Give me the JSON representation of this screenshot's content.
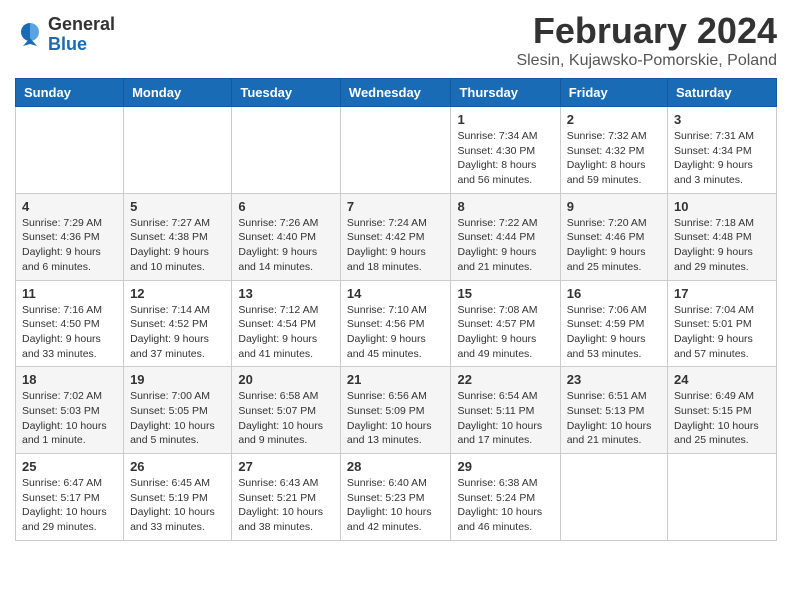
{
  "logo": {
    "general": "General",
    "blue": "Blue"
  },
  "title": {
    "month_year": "February 2024",
    "location": "Slesin, Kujawsko-Pomorskie, Poland"
  },
  "days_of_week": [
    "Sunday",
    "Monday",
    "Tuesday",
    "Wednesday",
    "Thursday",
    "Friday",
    "Saturday"
  ],
  "weeks": [
    [
      {
        "day": "",
        "info": ""
      },
      {
        "day": "",
        "info": ""
      },
      {
        "day": "",
        "info": ""
      },
      {
        "day": "",
        "info": ""
      },
      {
        "day": "1",
        "info": "Sunrise: 7:34 AM\nSunset: 4:30 PM\nDaylight: 8 hours\nand 56 minutes."
      },
      {
        "day": "2",
        "info": "Sunrise: 7:32 AM\nSunset: 4:32 PM\nDaylight: 8 hours\nand 59 minutes."
      },
      {
        "day": "3",
        "info": "Sunrise: 7:31 AM\nSunset: 4:34 PM\nDaylight: 9 hours\nand 3 minutes."
      }
    ],
    [
      {
        "day": "4",
        "info": "Sunrise: 7:29 AM\nSunset: 4:36 PM\nDaylight: 9 hours\nand 6 minutes."
      },
      {
        "day": "5",
        "info": "Sunrise: 7:27 AM\nSunset: 4:38 PM\nDaylight: 9 hours\nand 10 minutes."
      },
      {
        "day": "6",
        "info": "Sunrise: 7:26 AM\nSunset: 4:40 PM\nDaylight: 9 hours\nand 14 minutes."
      },
      {
        "day": "7",
        "info": "Sunrise: 7:24 AM\nSunset: 4:42 PM\nDaylight: 9 hours\nand 18 minutes."
      },
      {
        "day": "8",
        "info": "Sunrise: 7:22 AM\nSunset: 4:44 PM\nDaylight: 9 hours\nand 21 minutes."
      },
      {
        "day": "9",
        "info": "Sunrise: 7:20 AM\nSunset: 4:46 PM\nDaylight: 9 hours\nand 25 minutes."
      },
      {
        "day": "10",
        "info": "Sunrise: 7:18 AM\nSunset: 4:48 PM\nDaylight: 9 hours\nand 29 minutes."
      }
    ],
    [
      {
        "day": "11",
        "info": "Sunrise: 7:16 AM\nSunset: 4:50 PM\nDaylight: 9 hours\nand 33 minutes."
      },
      {
        "day": "12",
        "info": "Sunrise: 7:14 AM\nSunset: 4:52 PM\nDaylight: 9 hours\nand 37 minutes."
      },
      {
        "day": "13",
        "info": "Sunrise: 7:12 AM\nSunset: 4:54 PM\nDaylight: 9 hours\nand 41 minutes."
      },
      {
        "day": "14",
        "info": "Sunrise: 7:10 AM\nSunset: 4:56 PM\nDaylight: 9 hours\nand 45 minutes."
      },
      {
        "day": "15",
        "info": "Sunrise: 7:08 AM\nSunset: 4:57 PM\nDaylight: 9 hours\nand 49 minutes."
      },
      {
        "day": "16",
        "info": "Sunrise: 7:06 AM\nSunset: 4:59 PM\nDaylight: 9 hours\nand 53 minutes."
      },
      {
        "day": "17",
        "info": "Sunrise: 7:04 AM\nSunset: 5:01 PM\nDaylight: 9 hours\nand 57 minutes."
      }
    ],
    [
      {
        "day": "18",
        "info": "Sunrise: 7:02 AM\nSunset: 5:03 PM\nDaylight: 10 hours\nand 1 minute."
      },
      {
        "day": "19",
        "info": "Sunrise: 7:00 AM\nSunset: 5:05 PM\nDaylight: 10 hours\nand 5 minutes."
      },
      {
        "day": "20",
        "info": "Sunrise: 6:58 AM\nSunset: 5:07 PM\nDaylight: 10 hours\nand 9 minutes."
      },
      {
        "day": "21",
        "info": "Sunrise: 6:56 AM\nSunset: 5:09 PM\nDaylight: 10 hours\nand 13 minutes."
      },
      {
        "day": "22",
        "info": "Sunrise: 6:54 AM\nSunset: 5:11 PM\nDaylight: 10 hours\nand 17 minutes."
      },
      {
        "day": "23",
        "info": "Sunrise: 6:51 AM\nSunset: 5:13 PM\nDaylight: 10 hours\nand 21 minutes."
      },
      {
        "day": "24",
        "info": "Sunrise: 6:49 AM\nSunset: 5:15 PM\nDaylight: 10 hours\nand 25 minutes."
      }
    ],
    [
      {
        "day": "25",
        "info": "Sunrise: 6:47 AM\nSunset: 5:17 PM\nDaylight: 10 hours\nand 29 minutes."
      },
      {
        "day": "26",
        "info": "Sunrise: 6:45 AM\nSunset: 5:19 PM\nDaylight: 10 hours\nand 33 minutes."
      },
      {
        "day": "27",
        "info": "Sunrise: 6:43 AM\nSunset: 5:21 PM\nDaylight: 10 hours\nand 38 minutes."
      },
      {
        "day": "28",
        "info": "Sunrise: 6:40 AM\nSunset: 5:23 PM\nDaylight: 10 hours\nand 42 minutes."
      },
      {
        "day": "29",
        "info": "Sunrise: 6:38 AM\nSunset: 5:24 PM\nDaylight: 10 hours\nand 46 minutes."
      },
      {
        "day": "",
        "info": ""
      },
      {
        "day": "",
        "info": ""
      }
    ]
  ]
}
